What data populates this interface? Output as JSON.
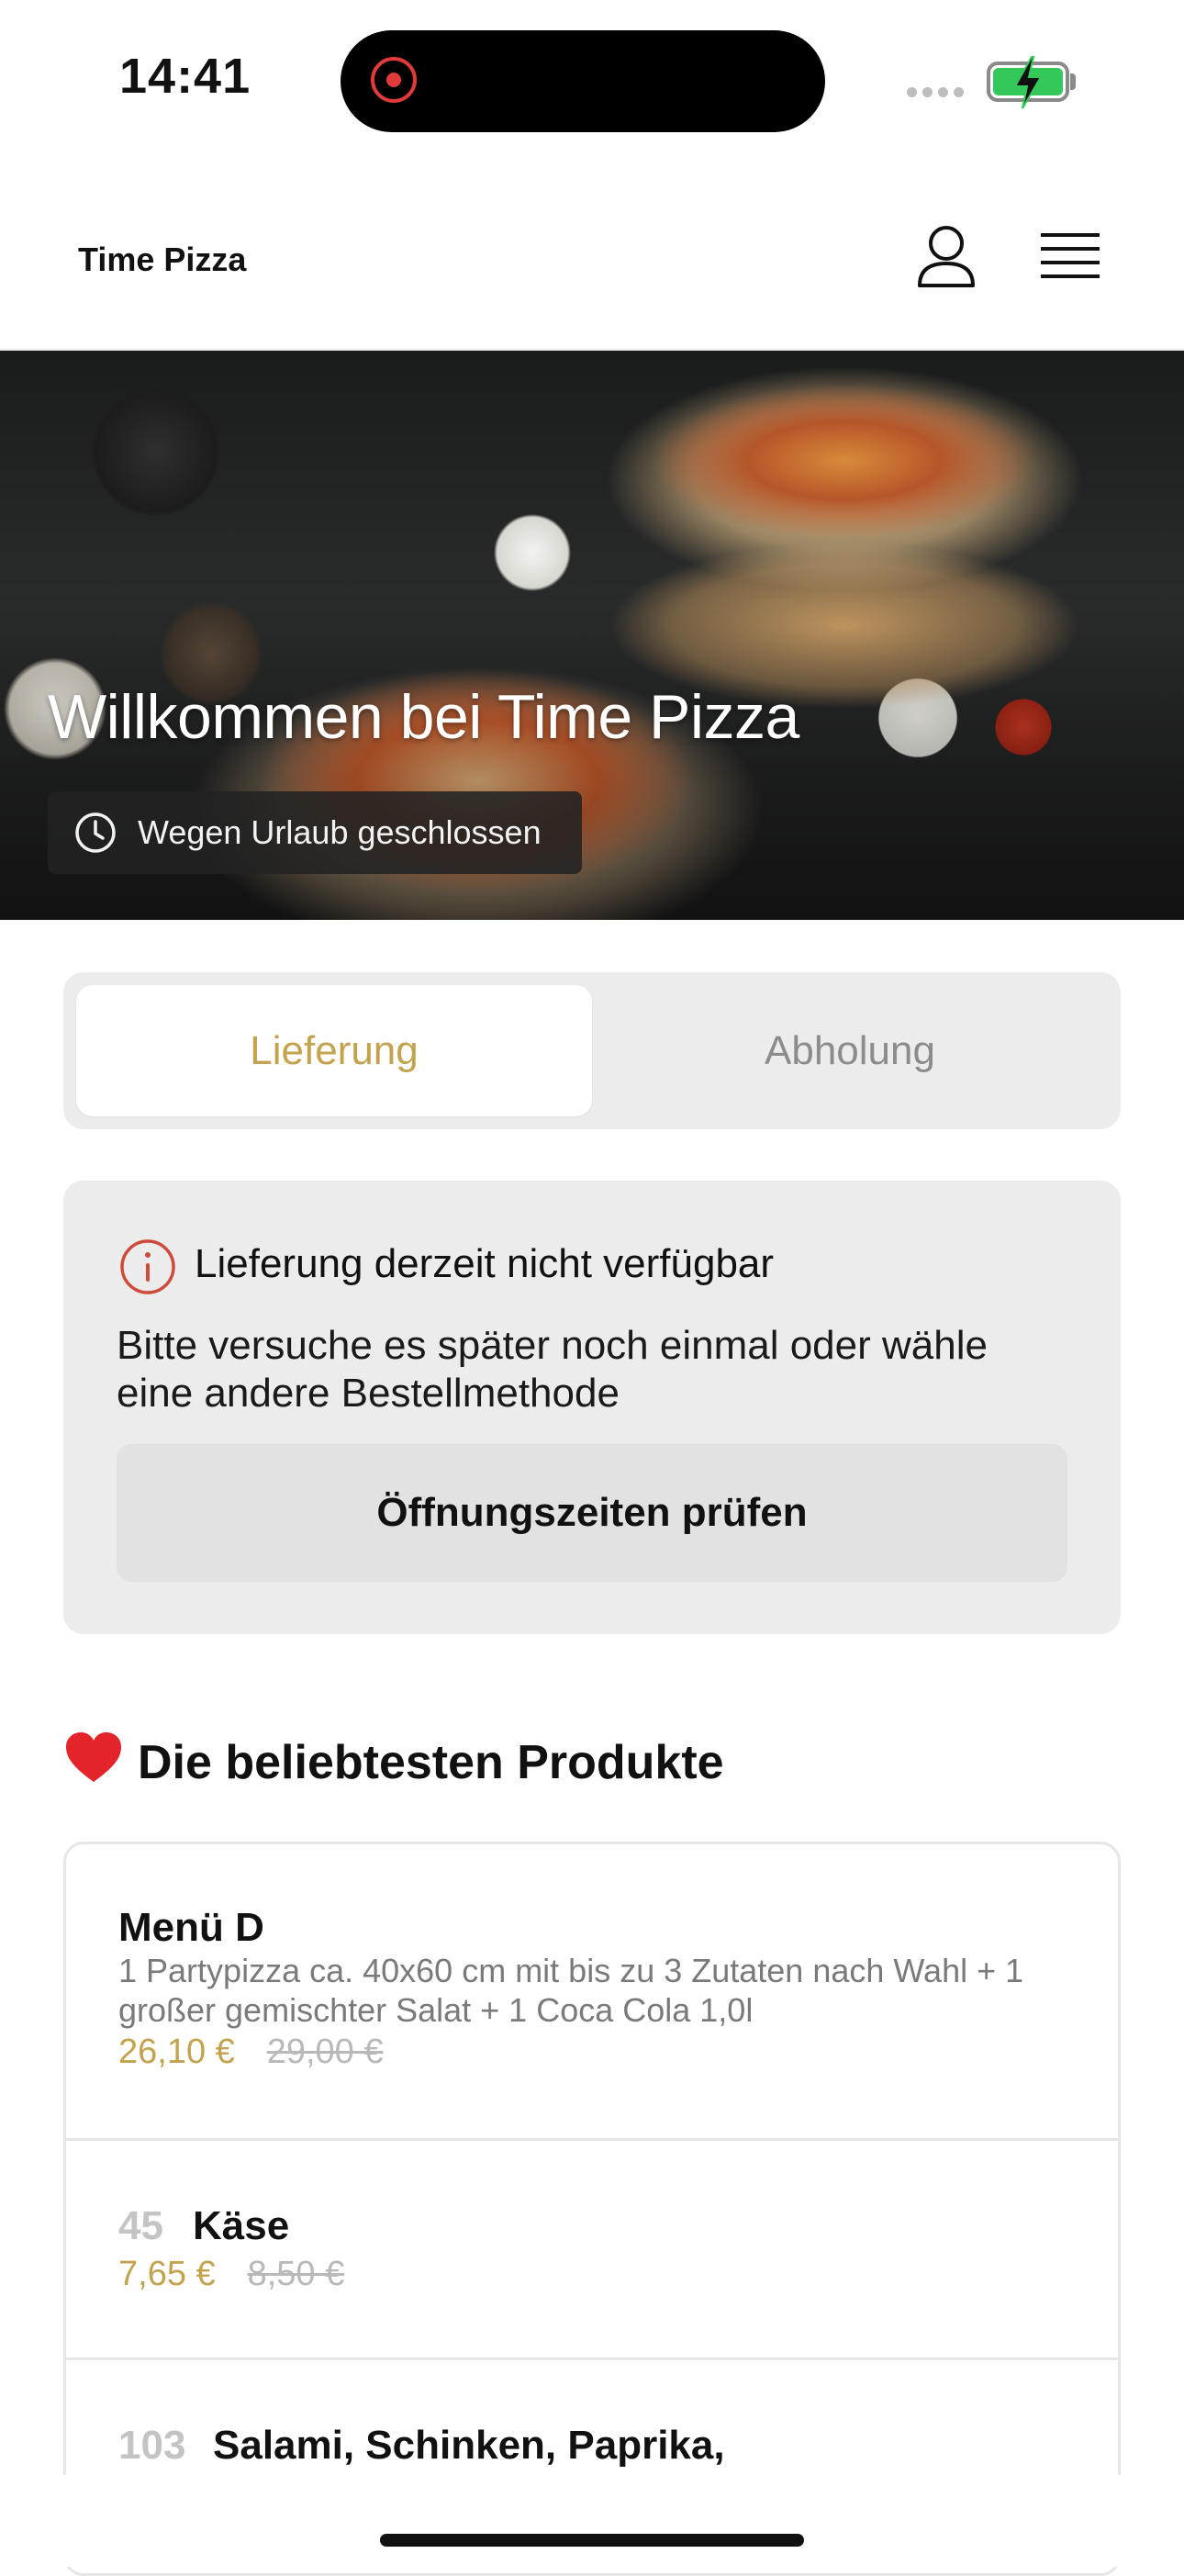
{
  "status_bar": {
    "time": "14:41"
  },
  "header": {
    "brand": "Time Pizza"
  },
  "hero": {
    "title": "Willkommen bei Time Pizza",
    "badge_text": "Wegen Urlaub geschlossen"
  },
  "tabs": [
    {
      "label": "Lieferung",
      "active": true
    },
    {
      "label": "Abholung",
      "active": false
    }
  ],
  "notice": {
    "title": "Lieferung derzeit nicht verfügbar",
    "body": "Bitte versuche es später noch einmal oder wähle eine andere Bestellmethode",
    "button_label": "Öffnungszeiten prüfen"
  },
  "section": {
    "title": "Die beliebtesten Produkte"
  },
  "products": [
    {
      "number": "",
      "name": "Menü D",
      "description": "1 Partypizza ca. 40x60 cm mit bis zu 3 Zutaten nach Wahl + 1 großer gemischter Salat + 1 Coca Cola 1,0l",
      "price": "26,10 €",
      "old_price": "29,00 €"
    },
    {
      "number": "45",
      "name": "Käse",
      "price": "7,65 €",
      "old_price": "8,50 €"
    },
    {
      "number": "103",
      "name": "Salami, Schinken, Paprika,"
    }
  ],
  "colors": {
    "accent": "#c3a34d",
    "inactive_text": "#8c8c8c",
    "card_bg": "#ececec",
    "alert_red": "#d04a3c"
  },
  "icons": [
    "user-icon",
    "menu-icon",
    "clock-icon",
    "info-icon",
    "heart-icon"
  ]
}
